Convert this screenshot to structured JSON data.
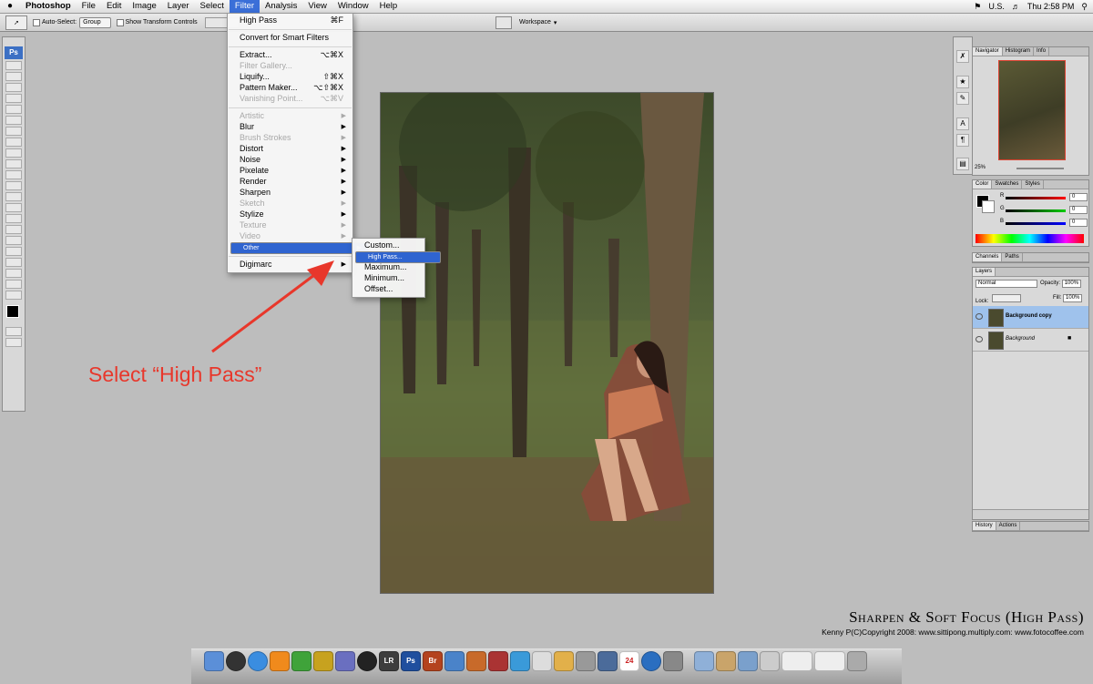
{
  "menubar": {
    "app_name": "Photoshop",
    "items": [
      "File",
      "Edit",
      "Image",
      "Layer",
      "Select",
      "Filter",
      "Analysis",
      "View",
      "Window",
      "Help"
    ],
    "active_item": "Filter",
    "input_source": "U.S.",
    "clock": "Thu 2:58 PM"
  },
  "options_bar": {
    "auto_select_label": "Auto-Select:",
    "auto_select_value": "Group",
    "show_transform_label": "Show Transform Controls",
    "workspace_label": "Workspace"
  },
  "tools": {
    "badge": "Ps"
  },
  "filter_menu": {
    "last_filter": "High Pass",
    "last_filter_shortcut": "⌘F",
    "convert_smart": "Convert for Smart Filters",
    "items": [
      {
        "label": "Extract...",
        "shortcut": "⌥⌘X",
        "enabled": true
      },
      {
        "label": "Filter Gallery...",
        "shortcut": "",
        "enabled": false
      },
      {
        "label": "Liquify...",
        "shortcut": "⇧⌘X",
        "enabled": true
      },
      {
        "label": "Pattern Maker...",
        "shortcut": "⌥⇧⌘X",
        "enabled": true
      },
      {
        "label": "Vanishing Point...",
        "shortcut": "⌥⌘V",
        "enabled": false
      }
    ],
    "submenus": [
      {
        "label": "Artistic",
        "enabled": false
      },
      {
        "label": "Blur",
        "enabled": true
      },
      {
        "label": "Brush Strokes",
        "enabled": false
      },
      {
        "label": "Distort",
        "enabled": true
      },
      {
        "label": "Noise",
        "enabled": true
      },
      {
        "label": "Pixelate",
        "enabled": true
      },
      {
        "label": "Render",
        "enabled": true
      },
      {
        "label": "Sharpen",
        "enabled": true
      },
      {
        "label": "Sketch",
        "enabled": false
      },
      {
        "label": "Stylize",
        "enabled": true
      },
      {
        "label": "Texture",
        "enabled": false
      },
      {
        "label": "Video",
        "enabled": false
      },
      {
        "label": "Other",
        "enabled": true
      }
    ],
    "digimarc": "Digimarc"
  },
  "other_submenu": {
    "items": [
      "Custom...",
      "High Pass...",
      "Maximum...",
      "Minimum...",
      "Offset..."
    ],
    "selected": "High Pass..."
  },
  "annotation": {
    "text": "Select “High Pass”"
  },
  "panels": {
    "navigator_tabs": [
      "Navigator",
      "Histogram",
      "Info"
    ],
    "zoom": "25%",
    "color_tabs": [
      "Color",
      "Swatches",
      "Styles"
    ],
    "color_channels": [
      {
        "label": "R",
        "value": "0"
      },
      {
        "label": "G",
        "value": "0"
      },
      {
        "label": "B",
        "value": "0"
      }
    ],
    "channels_tabs": [
      "Channels",
      "Paths"
    ],
    "layers_tab": "Layers",
    "blend_mode": "Normal",
    "opacity_label": "Opacity:",
    "opacity_value": "100%",
    "lock_label": "Lock:",
    "fill_label": "Fill:",
    "fill_value": "100%",
    "layers": [
      {
        "name": "Background copy",
        "selected": true
      },
      {
        "name": "Background",
        "selected": false
      }
    ],
    "history_tabs": [
      "History",
      "Actions"
    ]
  },
  "title_block": {
    "title": "Sharpen & Soft Focus (High Pass)",
    "credit": "Kenny P(C)Copyright 2008: www.sittipong.multiply.com: www.fotocoffee.com"
  },
  "dock": {
    "labeled_icons": [
      "LR",
      "Ps",
      "Br",
      "24"
    ]
  },
  "colors": {
    "menu_highlight": "#2f64d0",
    "annotation": "#e8372b"
  }
}
